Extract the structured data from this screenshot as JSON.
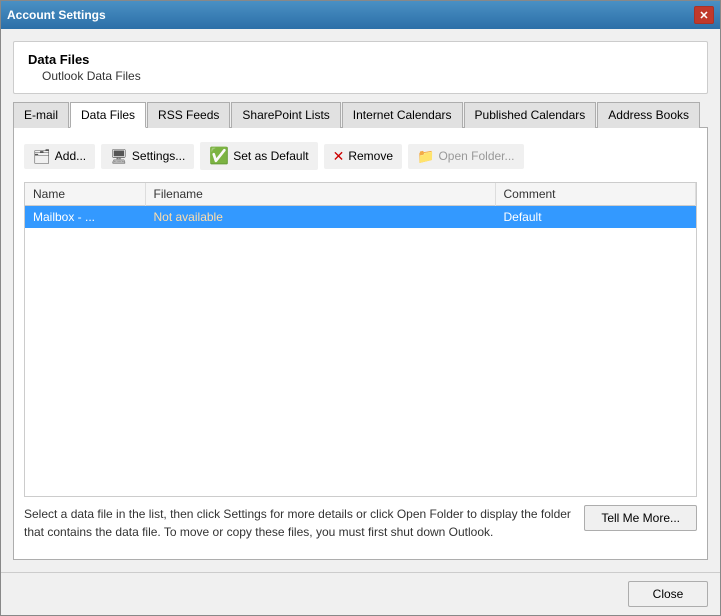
{
  "window": {
    "title": "Account Settings",
    "close_btn": "✕"
  },
  "header": {
    "title": "Data Files",
    "subtitle": "Outlook Data Files"
  },
  "tabs": [
    {
      "id": "email",
      "label": "E-mail",
      "active": false
    },
    {
      "id": "data-files",
      "label": "Data Files",
      "active": true
    },
    {
      "id": "rss-feeds",
      "label": "RSS Feeds",
      "active": false
    },
    {
      "id": "sharepoint",
      "label": "SharePoint Lists",
      "active": false
    },
    {
      "id": "internet-cal",
      "label": "Internet Calendars",
      "active": false
    },
    {
      "id": "published-cal",
      "label": "Published Calendars",
      "active": false
    },
    {
      "id": "address-books",
      "label": "Address Books",
      "active": false
    }
  ],
  "toolbar": {
    "add_label": "Add...",
    "settings_label": "Settings...",
    "set_default_label": "Set as Default",
    "remove_label": "Remove",
    "open_folder_label": "Open Folder..."
  },
  "table": {
    "columns": [
      {
        "key": "name",
        "label": "Name"
      },
      {
        "key": "filename",
        "label": "Filename"
      },
      {
        "key": "comment",
        "label": "Comment"
      }
    ],
    "rows": [
      {
        "name": "Mailbox - ...",
        "filename": "Not available",
        "comment": "Default",
        "selected": true
      }
    ]
  },
  "info_text": "Select a data file in the list, then click Settings for more details or click Open Folder to display the folder that contains the data file. To move or copy these files, you must first shut down Outlook.",
  "tell_me_more_btn": "Tell Me More...",
  "close_btn": "Close"
}
